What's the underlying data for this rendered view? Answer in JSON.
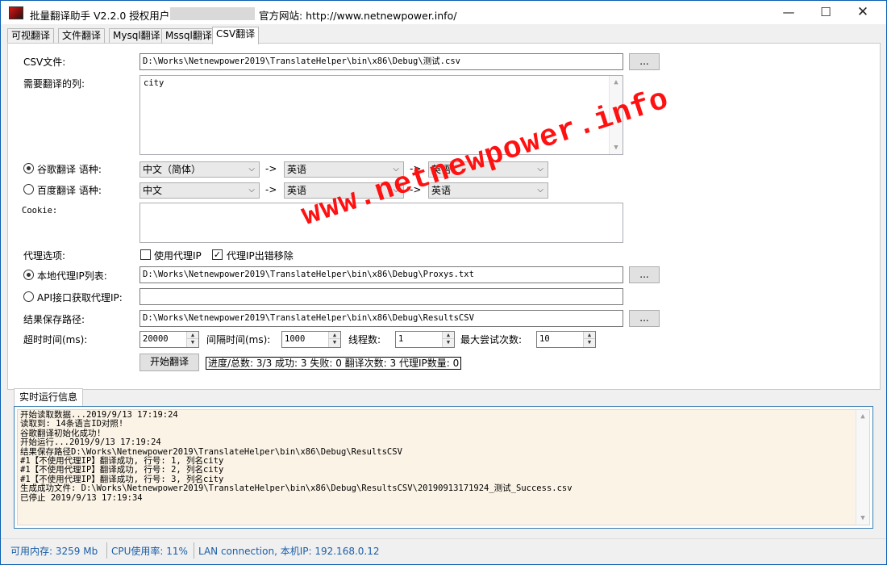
{
  "window": {
    "title": "批量翻译助手 V2.2.0 授权用户:",
    "site_label": "官方网站: http://www.netnewpower.info/",
    "minimize_glyph": "—",
    "maximize_glyph": "☐",
    "close_glyph": "✕"
  },
  "tabs": [
    {
      "label": "可视翻译"
    },
    {
      "label": "文件翻译"
    },
    {
      "label": "Mysql翻译"
    },
    {
      "label": "Mssql翻译"
    },
    {
      "label": "CSV翻译"
    }
  ],
  "form": {
    "csv_file_label": "CSV文件:",
    "csv_file_value": "D:\\Works\\Netnewpower2019\\TranslateHelper\\bin\\x86\\Debug\\测试.csv",
    "browse_label": "...",
    "columns_label": "需要翻译的列:",
    "columns_value": "city",
    "google_label": "谷歌翻译 语种:",
    "google_from": "中文（简体）",
    "google_mid": "英语",
    "google_to": "英语",
    "baidu_label": "百度翻译 语种:",
    "baidu_from": "中文",
    "baidu_mid": "英语",
    "baidu_to": "英语",
    "arrow": "->",
    "cookie_label": "Cookie:",
    "cookie_value": "",
    "proxy_options_label": "代理选项:",
    "use_proxy_label": "使用代理IP",
    "remove_bad_proxy_label": "代理IP出错移除",
    "local_proxy_label": "本地代理IP列表:",
    "local_proxy_value": "D:\\Works\\Netnewpower2019\\TranslateHelper\\bin\\x86\\Debug\\Proxys.txt",
    "api_proxy_label": "API接口获取代理IP:",
    "api_proxy_value": "",
    "save_path_label": "结果保存路径:",
    "save_path_value": "D:\\Works\\Netnewpower2019\\TranslateHelper\\bin\\x86\\Debug\\ResultsCSV",
    "timeout_label": "超时时间(ms):",
    "timeout_value": "20000",
    "interval_label": "间隔时间(ms):",
    "interval_value": "1000",
    "threads_label": "线程数:",
    "threads_value": "1",
    "max_retry_label": "最大尝试次数:",
    "max_retry_value": "10",
    "start_label": "开始翻译",
    "progress_text": "进度/总数: 3/3 成功: 3 失败: 0 翻译次数: 3 代理IP数量: 0"
  },
  "watermark": "www.netnewpower.info",
  "log": {
    "tab_label": "实时运行信息",
    "lines": [
      "开始读取数据...2019/9/13 17:19:24",
      "读取到: 14条语言ID对照!",
      "谷歌翻译初始化成功!",
      "开始运行...2019/9/13 17:19:24",
      "结果保存路径D:\\Works\\Netnewpower2019\\TranslateHelper\\bin\\x86\\Debug\\ResultsCSV",
      "#1【不使用代理IP】翻译成功, 行号: 1, 列名city",
      "#1【不使用代理IP】翻译成功, 行号: 2, 列名city",
      "#1【不使用代理IP】翻译成功, 行号: 3, 列名city",
      "生成成功文件: D:\\Works\\Netnewpower2019\\TranslateHelper\\bin\\x86\\Debug\\ResultsCSV\\20190913171924_测试_Success.csv",
      "已停止 2019/9/13 17:19:34"
    ]
  },
  "status": {
    "memory": "可用内存: 3259 Mb",
    "cpu": "CPU使用率: 11%",
    "network": "LAN connection, 本机IP: 192.168.0.12"
  },
  "colors": {
    "window_border": "#0b5fb3",
    "status_text": "#1a5ea8",
    "watermark": "#ff1111",
    "log_background": "#fbf3e6"
  }
}
